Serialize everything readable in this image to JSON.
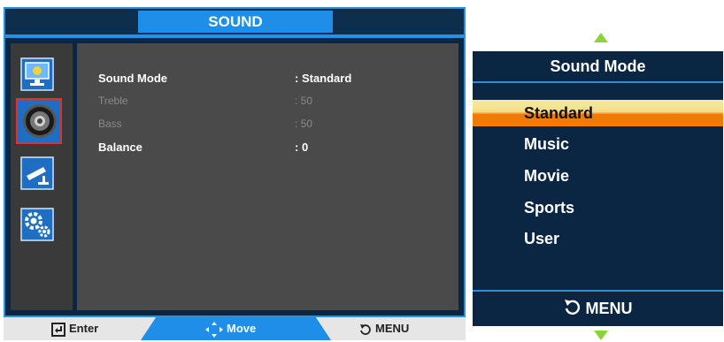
{
  "osd": {
    "title": "SOUND",
    "categories": [
      {
        "name": "picture",
        "icon": "picture-icon",
        "selected": false
      },
      {
        "name": "sound",
        "icon": "speaker-icon",
        "selected": true
      },
      {
        "name": "channel",
        "icon": "antenna-icon",
        "selected": false
      },
      {
        "name": "setup",
        "icon": "gear-icon",
        "selected": false
      }
    ],
    "settings": [
      {
        "label": "Sound Mode",
        "value": ": Standard",
        "enabled": true
      },
      {
        "label": "Treble",
        "value": ": 50",
        "enabled": false
      },
      {
        "label": "Bass",
        "value": ": 50",
        "enabled": false
      },
      {
        "label": "Balance",
        "value": ": 0",
        "enabled": true
      }
    ],
    "footer": {
      "enter_label": "Enter",
      "move_label": "Move",
      "menu_label": "MENU"
    }
  },
  "popup": {
    "title": "Sound Mode",
    "options": [
      "Standard",
      "Music",
      "Movie",
      "Sports",
      "User"
    ],
    "selected_index": 0,
    "footer_label": "MENU"
  },
  "colors": {
    "accent_blue": "#1e8ee8",
    "panel_navy": "#0a2642",
    "highlight_orange": "#f27d00",
    "arrow_green": "#8bd33a"
  }
}
